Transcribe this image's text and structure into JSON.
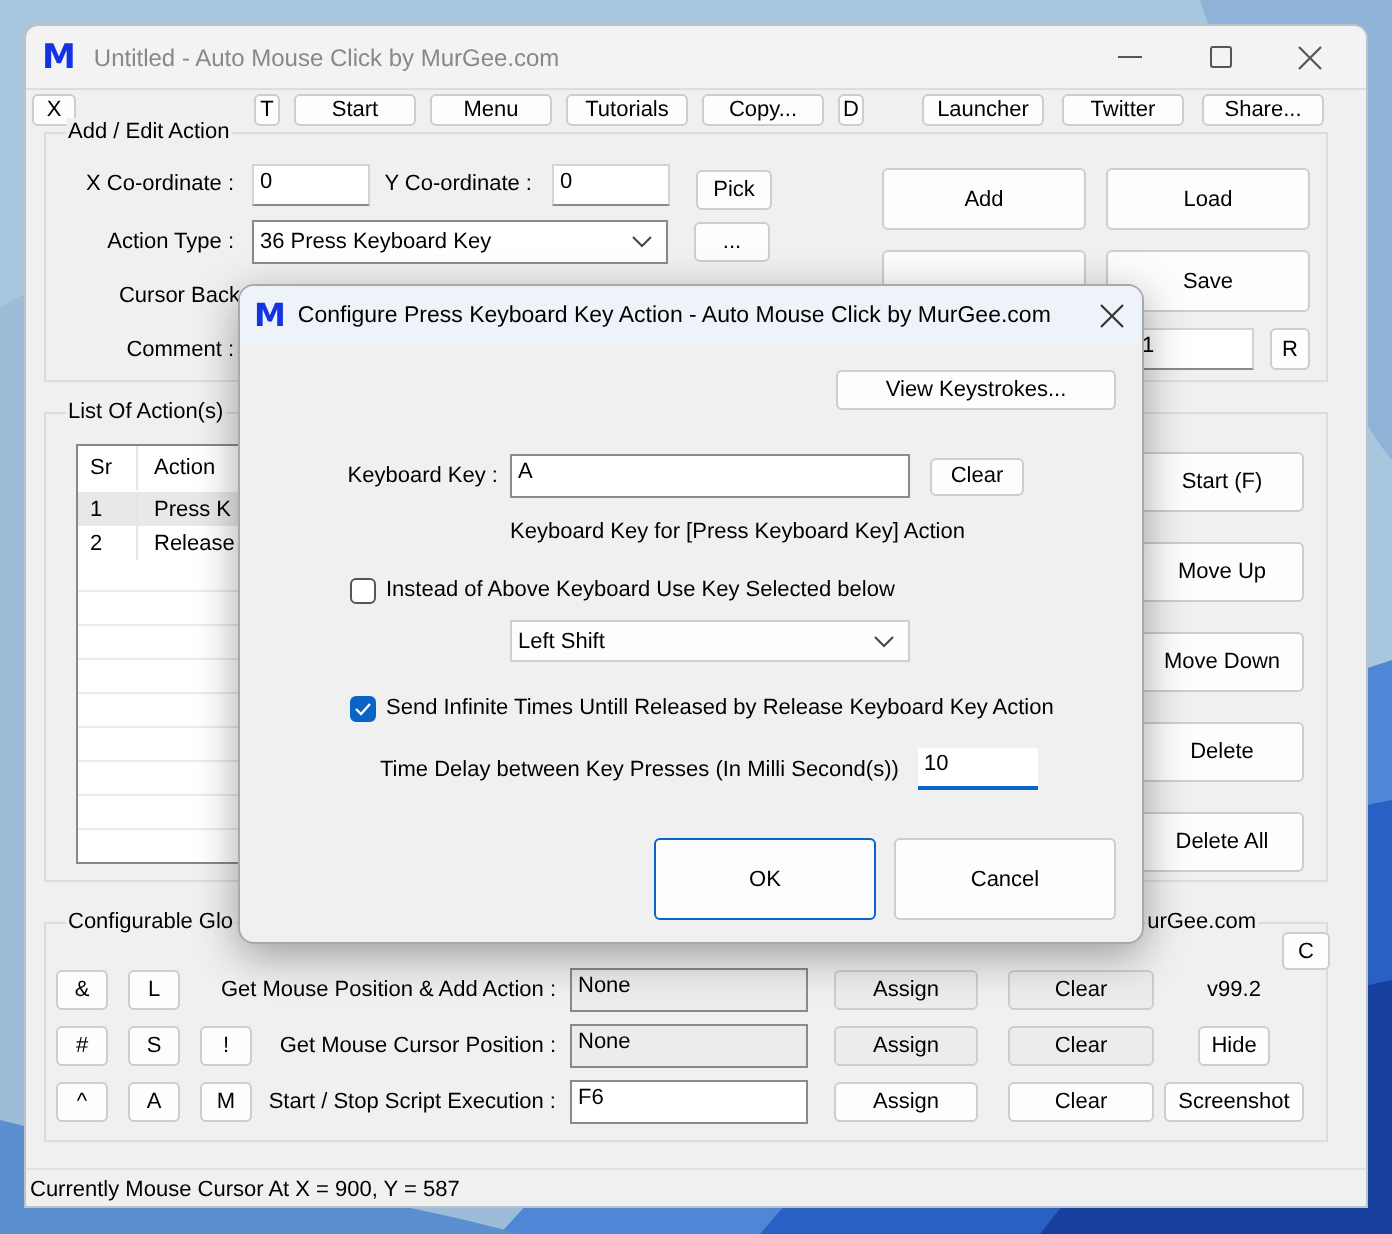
{
  "window": {
    "logo": "M",
    "title": "Untitled - Auto Mouse Click by MurGee.com"
  },
  "close_key": "X",
  "toolbar_left": [
    {
      "label": "T",
      "kind": "key"
    },
    {
      "label": "Start",
      "kind": "button"
    },
    {
      "label": "Menu",
      "kind": "button"
    },
    {
      "label": "Tutorials",
      "kind": "button"
    },
    {
      "label": "Copy...",
      "kind": "button"
    },
    {
      "label": "D",
      "kind": "key"
    }
  ],
  "toolbar_right": [
    {
      "label": "Launcher",
      "kind": "button"
    },
    {
      "label": "Twitter",
      "kind": "button"
    },
    {
      "label": "Share...",
      "kind": "button"
    }
  ],
  "add_edit": {
    "title": "Add / Edit Action",
    "x_label": "X Co-ordinate :",
    "x_value": "0",
    "y_label": "Y Co-ordinate :",
    "y_value": "0",
    "pick": "Pick",
    "action_type_label": "Action Type :",
    "action_type": "36  Press Keyboard Key",
    "more": "...",
    "cursor_back_label": "Cursor Back",
    "comment_label": "Comment :",
    "buttons": [
      "Add",
      "Load",
      "Save"
    ],
    "repeat_value": "1",
    "reset": "R"
  },
  "actions": {
    "title": "List Of Action(s)",
    "columns": [
      "Sr",
      "Action"
    ],
    "rows": [
      {
        "sr": "1",
        "action": "Press K",
        "selected": true
      },
      {
        "sr": "2",
        "action": "Release",
        "selected": false
      }
    ],
    "buttons": [
      "Start (F)",
      "Move Up",
      "Move Down",
      "Delete",
      "Delete All"
    ]
  },
  "hotkeys": {
    "title": "Configurable Glo",
    "site": "urGee.com",
    "corner": "C",
    "rows": [
      {
        "keys": [
          "&",
          "L"
        ],
        "label": "Get Mouse Position & Add Action :",
        "value": "None",
        "disabled": true,
        "assign": "Assign",
        "clear": "Clear",
        "version": "v99.2"
      },
      {
        "keys": [
          "#",
          "S",
          "!"
        ],
        "label": "Get Mouse Cursor Position :",
        "value": "None",
        "disabled": true,
        "assign": "Assign",
        "clear": "Clear",
        "button": "Hide"
      },
      {
        "keys": [
          "^",
          "A",
          "M"
        ],
        "label": "Start / Stop Script Execution :",
        "value": "F6",
        "disabled": false,
        "assign": "Assign",
        "clear": "Clear",
        "button": "Screenshot"
      }
    ]
  },
  "status_bar": "Currently Mouse Cursor At X = 900, Y = 587",
  "dialog": {
    "logo": "M",
    "title": "Configure Press Keyboard Key Action - Auto Mouse Click by MurGee.com",
    "view_keystrokes": "View Keystrokes...",
    "key_label": "Keyboard Key :",
    "key_value": "A",
    "clear": "Clear",
    "key_hint": "Keyboard Key for [Press Keyboard Key] Action",
    "use_selected": {
      "label": "Instead of Above Keyboard Use Key Selected below",
      "checked": false
    },
    "selected_key": "Left Shift",
    "infinite": {
      "label": "Send Infinite Times Untill Released by Release Keyboard Key Action",
      "checked": true
    },
    "delay_label": "Time Delay between Key Presses (In Milli Second(s))",
    "delay_value": "10",
    "buttons": [
      {
        "label": "OK",
        "default": true
      },
      {
        "label": "Cancel",
        "default": false
      }
    ]
  }
}
